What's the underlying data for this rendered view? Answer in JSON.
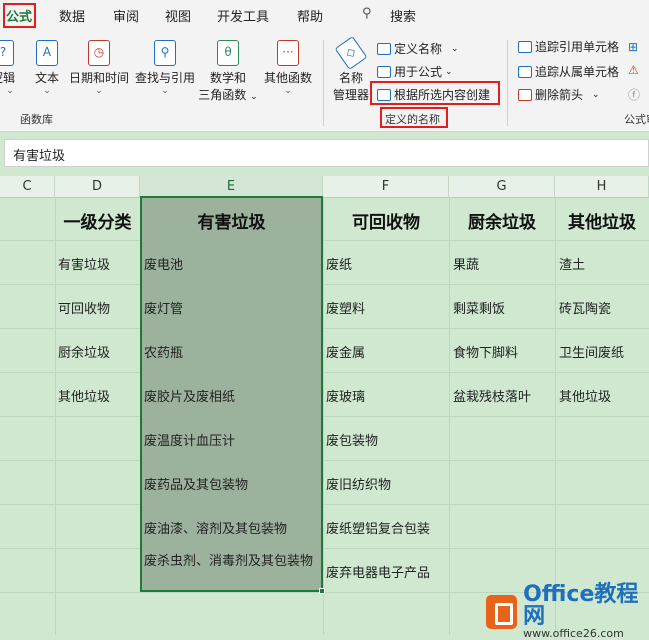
{
  "tabs": [
    {
      "label": "公式"
    },
    {
      "label": "数据"
    },
    {
      "label": "审阅"
    },
    {
      "label": "视图"
    },
    {
      "label": "开发工具"
    },
    {
      "label": "帮助"
    }
  ],
  "search_label": "搜索",
  "ribbon": {
    "logic_label": "逻辑",
    "text_label": "文本",
    "datetime_label": "日期和时间",
    "lookup_label": "查找与引用",
    "math_label_1": "数学和",
    "math_label_2": "三角函数",
    "other_label": "其他函数",
    "function_library_group": "函数库",
    "name_manager_1": "名称",
    "name_manager_2": "管理器",
    "define_name": "定义名称",
    "use_in_formula": "用于公式",
    "create_from_selection": "根据所选内容创建",
    "defined_names_group": "定义的名称",
    "trace_precedents": "追踪引用单元格",
    "trace_dependents": "追踪从属单元格",
    "remove_arrows": "删除箭头",
    "formula_audit_group": "公式审",
    "dropdown_symbol": "⌄"
  },
  "formula_bar": {
    "value": "有害垃圾"
  },
  "columns": [
    "C",
    "D",
    "E",
    "F",
    "G",
    "H"
  ],
  "headers": [
    "一级分类",
    "有害垃圾",
    "可回收物",
    "厨余垃圾",
    "其他垃圾"
  ],
  "col_d": [
    "有害垃圾",
    "可回收物",
    "厨余垃圾",
    "其他垃圾"
  ],
  "col_e": [
    "废电池",
    "废灯管",
    "农药瓶",
    "废胶片及废相纸",
    "废温度计血压计",
    "废药品及其包装物",
    "废油漆、溶剂及其包装物",
    "废杀虫剂、消毒剂及其包装物"
  ],
  "col_f": [
    "废纸",
    "废塑料",
    "废金属",
    "废玻璃",
    "废包装物",
    "废旧纺织物",
    "废纸塑铝复合包装",
    "废弃电器电子产品"
  ],
  "col_g": [
    "果蔬",
    "剩菜剩饭",
    "食物下脚料",
    "盆栽残枝落叶"
  ],
  "col_h": [
    "渣土",
    "砖瓦陶瓷",
    "卫生间废纸",
    "其他垃圾"
  ],
  "watermark": {
    "brand": "Office教程网",
    "url": "www.office26.com"
  },
  "colors": {
    "accent": "#1d7a3c",
    "highlight": "#e02020",
    "sheet_bg": "#cfe8cf",
    "selection": "#9cb29c"
  }
}
